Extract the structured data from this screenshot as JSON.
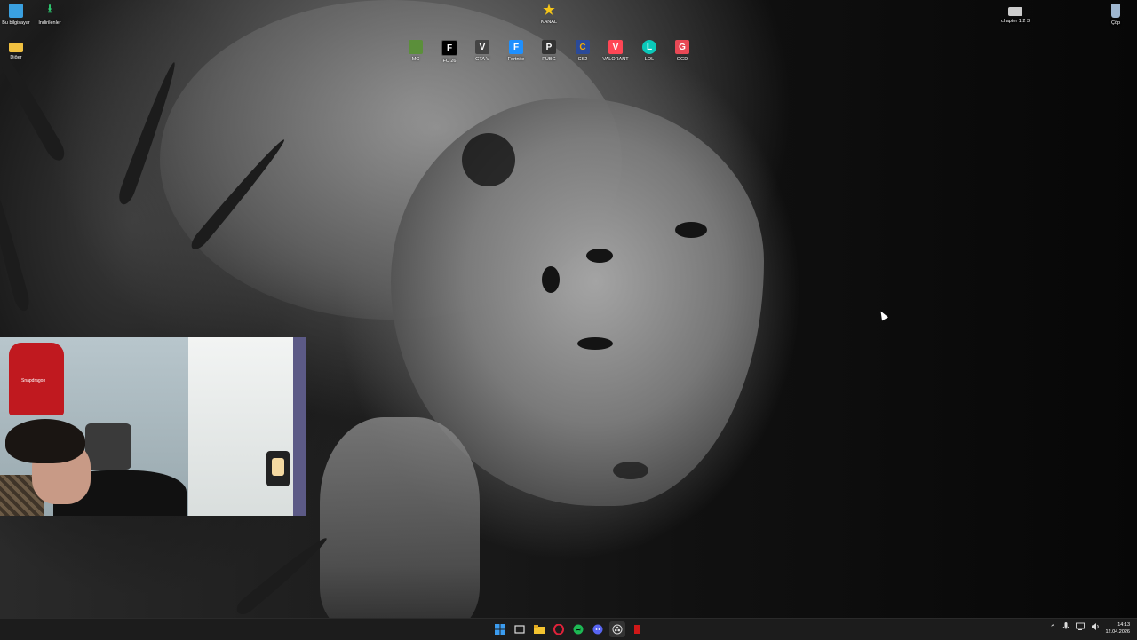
{
  "desktop": {
    "icons_left": [
      {
        "label": "Bu bilgisayar",
        "icon": "computer-icon",
        "color": "#3aa0e0"
      },
      {
        "label": "İndirilenler",
        "icon": "download-icon",
        "color": "#2ecc71"
      },
      {
        "label": "Diğer",
        "icon": "folder-icon",
        "color": "#f0c040"
      }
    ],
    "icon_center_top": {
      "label": "KANAL",
      "icon": "star-icon",
      "color": "#f5c518"
    },
    "game_icons": [
      {
        "label": "MC",
        "icon": "minecraft-icon",
        "color": "#5b8f3a",
        "glyph": "■"
      },
      {
        "label": "FC 26",
        "icon": "fc26-icon",
        "color": "#000000",
        "glyph": "F"
      },
      {
        "label": "GTA V",
        "icon": "gtav-icon",
        "color": "#444444",
        "glyph": "V"
      },
      {
        "label": "Fortnite",
        "icon": "fortnite-icon",
        "color": "#1e90ff",
        "glyph": "F"
      },
      {
        "label": "PUBG",
        "icon": "pubg-icon",
        "color": "#333333",
        "glyph": "P"
      },
      {
        "label": "CS2",
        "icon": "cs2-icon",
        "color": "#f2a900",
        "glyph": "C"
      },
      {
        "label": "VALORANT",
        "icon": "valorant-icon",
        "color": "#ff4655",
        "glyph": "V"
      },
      {
        "label": "LOL",
        "icon": "lol-icon",
        "color": "#0ac8b9",
        "glyph": "L"
      },
      {
        "label": "GGD",
        "icon": "ggd-icon",
        "color": "#e84855",
        "glyph": "G"
      }
    ],
    "icons_right": [
      {
        "label": "chapter 1 2 3",
        "icon": "video-file-icon",
        "color": "#cccccc"
      },
      {
        "label": "Çöp",
        "icon": "recycle-bin-icon",
        "color": "#9fb7d0"
      }
    ]
  },
  "webcam": {
    "jersey_text": "Snapdragon"
  },
  "taskbar": {
    "apps": [
      {
        "name": "start",
        "icon": "windows-start-icon",
        "color": "#3b9cf0"
      },
      {
        "name": "task-view",
        "icon": "task-view-icon",
        "color": "#dddddd"
      },
      {
        "name": "file-explorer",
        "icon": "file-explorer-icon",
        "color": "#f4c430"
      },
      {
        "name": "opera",
        "icon": "opera-icon",
        "color": "#e0223a"
      },
      {
        "name": "spotify",
        "icon": "spotify-icon",
        "color": "#1db954"
      },
      {
        "name": "discord",
        "icon": "discord-icon",
        "color": "#5865f2"
      },
      {
        "name": "obs",
        "icon": "obs-icon",
        "color": "#dddddd"
      },
      {
        "name": "app-red",
        "icon": "red-app-icon",
        "color": "#d01818"
      }
    ],
    "tray": [
      "chevron-up-icon",
      "microphone-icon",
      "network-icon",
      "volume-icon"
    ],
    "time": "14:13",
    "date": "12.04.2026"
  }
}
